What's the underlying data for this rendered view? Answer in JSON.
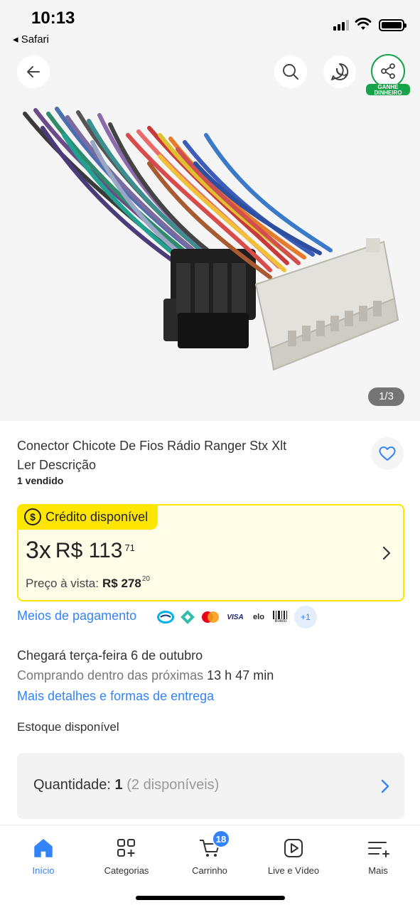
{
  "status_bar": {
    "time": "10:13",
    "back_app": "◂ Safari"
  },
  "gallery": {
    "counter": "1/3",
    "earn_badge": "GANHE DINHEIRO"
  },
  "product": {
    "title_line1": "Conector Chicote De Fios Rádio Ranger Stx Xlt",
    "title_line2": "Ler Descrição",
    "sold": "1 vendido"
  },
  "credit": {
    "tag": "Crédito disponível",
    "coin_symbol": "$",
    "installments": "3x",
    "installment_price": "R$ 113",
    "installment_cents": "71",
    "cash_label": "Preço à vista:",
    "cash_price": "R$ 278",
    "cash_cents": "20"
  },
  "payment": {
    "link": "Meios de pagamento",
    "methods": [
      "mercado-pago",
      "pix",
      "mastercard",
      "VISA",
      "elo",
      "Boleto"
    ],
    "more": "+1"
  },
  "shipping": {
    "arrival": "Chegará terça-feira 6 de outubro",
    "buy_within_prefix": "Comprando dentro das próximas",
    "buy_within_time": "13 h 47 min",
    "details_link": "Mais detalhes e formas de entrega"
  },
  "stock": {
    "label": "Estoque disponível",
    "quantity_label": "Quantidade:",
    "quantity_value": "1",
    "available": "(2 disponíveis)"
  },
  "bottom_nav": {
    "items": [
      {
        "label": "Início",
        "icon": "home-icon"
      },
      {
        "label": "Categorias",
        "icon": "categories-icon"
      },
      {
        "label": "Carrinho",
        "icon": "cart-icon"
      },
      {
        "label": "Live e Vídeo",
        "icon": "video-icon"
      },
      {
        "label": "Mais",
        "icon": "menu-icon"
      }
    ],
    "cart_count": "18"
  },
  "colors": {
    "accent": "#3483fa",
    "credit_yellow": "#ffe600",
    "earn_green": "#16a34a"
  }
}
